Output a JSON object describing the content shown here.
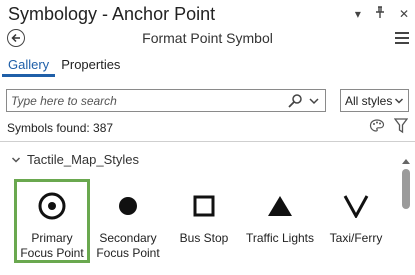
{
  "window": {
    "title": "Symbology - Anchor Point",
    "controls": {
      "options": "▾",
      "pin": "⊥",
      "close": "✕"
    }
  },
  "header": {
    "subtitle": "Format Point Symbol"
  },
  "tabs": [
    {
      "label": "Gallery",
      "active": true
    },
    {
      "label": "Properties",
      "active": false
    }
  ],
  "search": {
    "placeholder": "Type here to search",
    "value": ""
  },
  "styles_dropdown": {
    "selected": "All styles"
  },
  "status": {
    "symbols_found": "Symbols found: 387"
  },
  "gallery": {
    "group_name": "Tactile_Map_Styles",
    "symbols": [
      {
        "label": "Primary Focus Point",
        "icon": "target-circle-icon",
        "selected": true
      },
      {
        "label": "Secondary Focus Point",
        "icon": "filled-circle-icon",
        "selected": false
      },
      {
        "label": "Bus Stop",
        "icon": "hollow-square-icon",
        "selected": false
      },
      {
        "label": "Traffic Lights",
        "icon": "filled-triangle-icon",
        "selected": false
      },
      {
        "label": "Taxi/Ferry",
        "icon": "v-chevron-icon",
        "selected": false
      }
    ]
  },
  "colors": {
    "accent": "#1f5fa8",
    "selection": "#6aa84f"
  }
}
